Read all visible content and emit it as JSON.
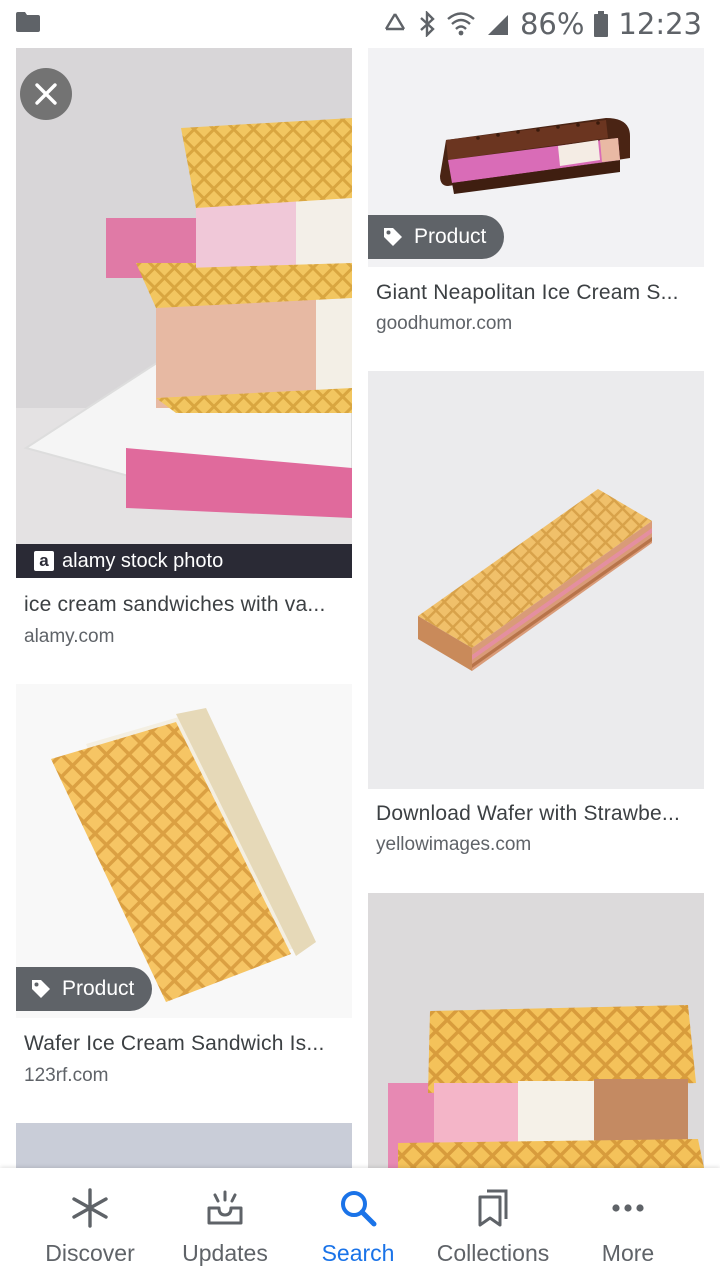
{
  "status_bar": {
    "battery": "86%",
    "time": "12:23",
    "icons": [
      "folder-icon",
      "recycle-icon",
      "bluetooth-icon",
      "wifi-icon",
      "signal-icon",
      "battery-icon"
    ]
  },
  "results": [
    {
      "title": "ice cream sandwiches with va...",
      "domain": "alamy.com",
      "watermark": "alamy stock photo",
      "has_close": true
    },
    {
      "title": "Giant Neapolitan Ice Cream S...",
      "domain": "goodhumor.com",
      "badge": "Product"
    },
    {
      "title": "Download Wafer with Strawbe...",
      "domain": "yellowimages.com"
    },
    {
      "title": "Wafer Ice Cream Sandwich Is...",
      "domain": "123rf.com",
      "badge": "Product"
    }
  ],
  "bottom_nav": {
    "items": [
      {
        "label": "Discover",
        "icon": "asterisk-icon"
      },
      {
        "label": "Updates",
        "icon": "inbox-icon"
      },
      {
        "label": "Search",
        "icon": "search-icon"
      },
      {
        "label": "Collections",
        "icon": "bookmark-icon"
      },
      {
        "label": "More",
        "icon": "more-horiz-icon"
      }
    ],
    "active": "Search",
    "active_color": "#1a73e8",
    "inactive_color": "#5f6368"
  }
}
